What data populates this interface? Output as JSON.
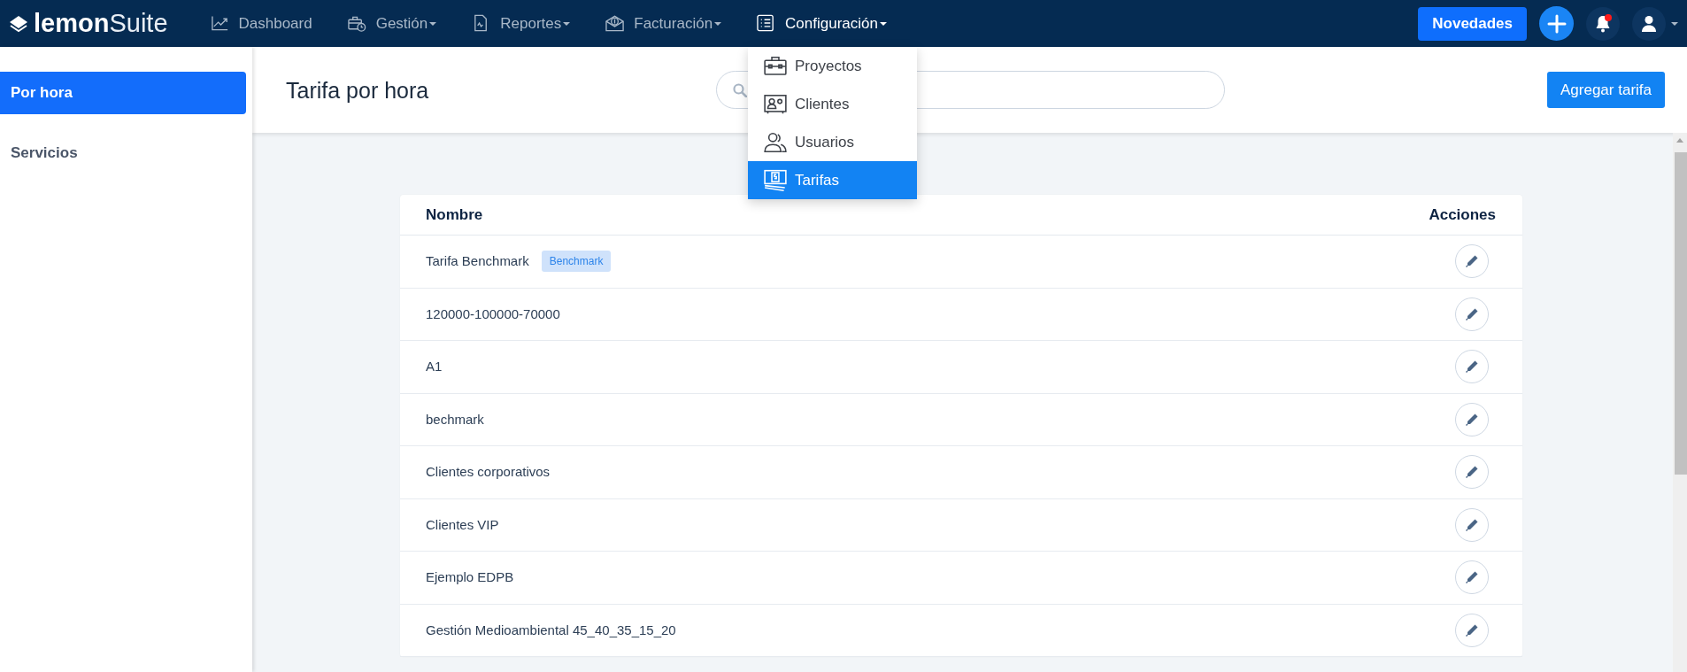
{
  "navbar": {
    "logo": {
      "bold": "lemon",
      "light": "Suite"
    },
    "menu": [
      {
        "label": "Dashboard",
        "kind": "chart",
        "dropdown": false,
        "selected": false
      },
      {
        "label": "Gestión",
        "kind": "briefcase-clock",
        "dropdown": true,
        "selected": false
      },
      {
        "label": "Reportes",
        "kind": "document",
        "dropdown": true,
        "selected": false
      },
      {
        "label": "Facturación",
        "kind": "envelope-dollar",
        "dropdown": true,
        "selected": false
      },
      {
        "label": "Configuración",
        "kind": "list",
        "dropdown": true,
        "selected": true
      }
    ],
    "news_button": "Novedades",
    "notification_dot": true
  },
  "config_menu": [
    {
      "label": "Proyectos",
      "kind": "briefcase",
      "selected": false
    },
    {
      "label": "Clientes",
      "kind": "contact-card",
      "selected": false
    },
    {
      "label": "Usuarios",
      "kind": "users",
      "selected": false
    },
    {
      "label": "Tarifas",
      "kind": "banknotes",
      "selected": true
    }
  ],
  "sidebar": [
    {
      "label": "Por hora",
      "selected": true
    },
    {
      "label": "Servicios",
      "selected": false
    }
  ],
  "header": {
    "title": "Tarifa por hora",
    "add_button": "Agregar tarifa"
  },
  "table": {
    "columns": [
      "Nombre",
      "Acciones"
    ],
    "rows": [
      {
        "name": "Tarifa Benchmark",
        "tag": "Benchmark"
      },
      {
        "name": "120000-100000-70000"
      },
      {
        "name": "A1"
      },
      {
        "name": "bechmark"
      },
      {
        "name": "Clientes corporativos"
      },
      {
        "name": "Clientes VIP"
      },
      {
        "name": "Ejemplo EDPB"
      },
      {
        "name": "Gestión Medioambiental 45_40_35_15_20"
      }
    ]
  }
}
